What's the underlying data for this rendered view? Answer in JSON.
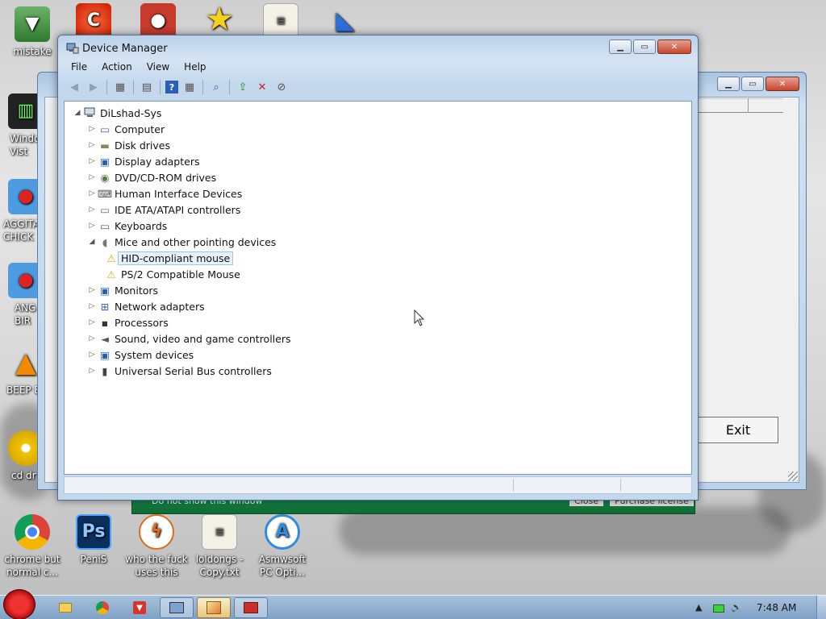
{
  "desktop": {
    "icons": [
      {
        "label": "mistake",
        "icon": "install-icon"
      },
      {
        "label": "Windo\nVist",
        "icon": "trash-can-icon"
      },
      {
        "label": "AGGITA\nCHICK",
        "icon": "angry-bird-icon"
      },
      {
        "label": "ANG\nBIR",
        "icon": "angry-bird-icon"
      },
      {
        "label": "BEEP B",
        "icon": "vlc-cone-icon"
      },
      {
        "label": "cd dr",
        "icon": "cd-disc-icon"
      },
      {
        "label": "chrome but\nnormal c...",
        "icon": "chrome-icon"
      },
      {
        "label": "PeniS",
        "icon": "photoshop-icon"
      },
      {
        "label": "who the fuck\nuses this",
        "icon": "flash-icon"
      },
      {
        "label": "loldongs -\nCopy.txt",
        "icon": "text-file-icon"
      },
      {
        "label": "Asmwsoft\nPC Opti...",
        "icon": "asmwsoft-icon"
      }
    ],
    "photoshop_glyph": "Ps"
  },
  "back_window": {
    "exit_label": "Exit"
  },
  "green_strip": {
    "text": "Do not show this window",
    "close_label": "Close",
    "purchase_label": "Purchase license"
  },
  "device_manager": {
    "title": "Device Manager",
    "menu": [
      "File",
      "Action",
      "View",
      "Help"
    ],
    "toolbar_icons": [
      "back-arrow-icon",
      "forward-arrow-icon",
      "show-hide-console-tree-icon",
      "properties-icon",
      "help-icon",
      "view-icon",
      "scan-hardware-icon",
      "update-driver-icon",
      "uninstall-icon",
      "disable-icon"
    ],
    "computer_name": "DiLshad-Sys",
    "categories": [
      {
        "label": "Computer",
        "icon": "computer-icon",
        "expanded": false
      },
      {
        "label": "Disk drives",
        "icon": "disk-drive-icon",
        "expanded": false
      },
      {
        "label": "Display adapters",
        "icon": "display-adapter-icon",
        "expanded": false
      },
      {
        "label": "DVD/CD-ROM drives",
        "icon": "dvd-drive-icon",
        "expanded": false
      },
      {
        "label": "Human Interface Devices",
        "icon": "hid-icon",
        "expanded": false
      },
      {
        "label": "IDE ATA/ATAPI controllers",
        "icon": "ide-controller-icon",
        "expanded": false
      },
      {
        "label": "Keyboards",
        "icon": "keyboard-icon",
        "expanded": false
      },
      {
        "label": "Mice and other pointing devices",
        "icon": "mouse-icon",
        "expanded": true,
        "children": [
          {
            "label": "HID-compliant mouse",
            "icon": "warning-mouse-icon",
            "selected": true
          },
          {
            "label": "PS/2 Compatible Mouse",
            "icon": "warning-mouse-icon",
            "selected": false
          }
        ]
      },
      {
        "label": "Monitors",
        "icon": "monitor-icon",
        "expanded": false
      },
      {
        "label": "Network adapters",
        "icon": "network-adapter-icon",
        "expanded": false
      },
      {
        "label": "Processors",
        "icon": "processor-icon",
        "expanded": false
      },
      {
        "label": "Sound, video and game controllers",
        "icon": "speaker-icon",
        "expanded": false
      },
      {
        "label": "System devices",
        "icon": "system-devices-icon",
        "expanded": false
      },
      {
        "label": "Universal Serial Bus controllers",
        "icon": "usb-icon",
        "expanded": false
      }
    ]
  },
  "taskbar": {
    "clock": "7:48 AM",
    "buttons": [
      "start-orb-icon",
      "explorer-icon",
      "chrome-icon",
      "download-icon",
      "device-manager-icon",
      "paint-icon",
      "toolbox-icon"
    ]
  },
  "colors": {
    "window_frame": "#c4d8ed",
    "selection_bg": "#e6f1fb",
    "taskbar": "#7fa1c6",
    "warning": "#f2c200"
  }
}
